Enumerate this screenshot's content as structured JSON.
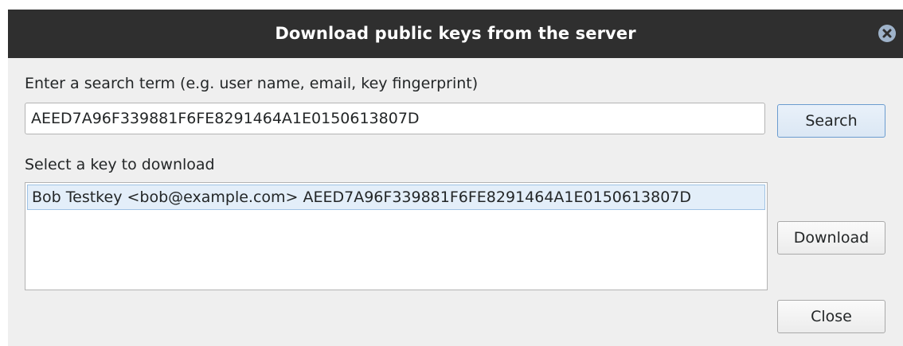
{
  "dialog": {
    "title": "Download public keys from the server"
  },
  "search": {
    "label": "Enter a search term (e.g. user name, email, key fingerprint)",
    "value": "AEED7A96F339881F6FE8291464A1E0150613807D",
    "button_label": "Search"
  },
  "keys": {
    "label": "Select a key to download",
    "items": [
      {
        "text": "Bob Testkey <bob@example.com> AEED7A96F339881F6FE8291464A1E0150613807D",
        "selected": true
      }
    ]
  },
  "actions": {
    "download_label": "Download",
    "close_label": "Close"
  },
  "icons": {
    "window_close": "close-circle-icon"
  },
  "colors": {
    "titlebar": "#2f2f2f",
    "dialog_bg": "#efefef",
    "selection": "#e3eef9",
    "close_icon": "#9fb3ca"
  }
}
